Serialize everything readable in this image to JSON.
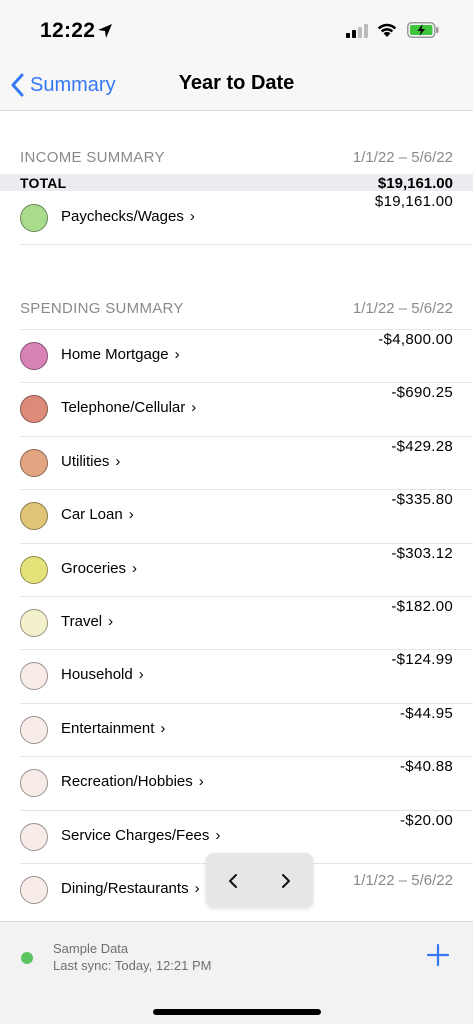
{
  "status_bar": {
    "time": "12:22"
  },
  "nav": {
    "back_label": "Summary",
    "title": "Year to Date"
  },
  "income": {
    "header": "INCOME SUMMARY",
    "date_range": "1/1/22 – 5/6/22",
    "total_label": "TOTAL",
    "total_amount": "$19,161.00",
    "items": [
      {
        "name": "Paychecks/Wages",
        "amount": "$19,161.00",
        "color": "#a8dc8c"
      }
    ]
  },
  "spending": {
    "header": "SPENDING SUMMARY",
    "date_range": "1/1/22 – 5/6/22",
    "items": [
      {
        "name": "Home Mortgage",
        "amount": "-$4,800.00",
        "color": "#d783b8"
      },
      {
        "name": "Telephone/Cellular",
        "amount": "-$690.25",
        "color": "#dc8a7a"
      },
      {
        "name": "Utilities",
        "amount": "-$429.28",
        "color": "#e2a582"
      },
      {
        "name": "Car Loan",
        "amount": "-$335.80",
        "color": "#e0c578"
      },
      {
        "name": "Groceries",
        "amount": "-$303.12",
        "color": "#e6e27a"
      },
      {
        "name": "Travel",
        "amount": "-$182.00",
        "color": "#f3f1cc"
      },
      {
        "name": "Household",
        "amount": "-$124.99",
        "color": "#f8ece8"
      },
      {
        "name": "Entertainment",
        "amount": "-$44.95",
        "color": "#f8ece8"
      },
      {
        "name": "Recreation/Hobbies",
        "amount": "-$40.88",
        "color": "#f8ece8"
      },
      {
        "name": "Service Charges/Fees",
        "amount": "-$20.00",
        "color": "#f8ece8"
      },
      {
        "name": "Dining/Restaurants",
        "amount": "",
        "color": "#f8ece8"
      }
    ]
  },
  "trailing_date_range": "1/1/22 – 5/6/22",
  "pager": {
    "prev": "‹",
    "next": "›"
  },
  "footer": {
    "sync_title": "Sample Data",
    "sync_status": "Last sync: Today, 12:21 PM",
    "sync_color": "#5ec462",
    "add_icon": "plus-icon"
  },
  "colors": {
    "accent": "#3478f6"
  }
}
